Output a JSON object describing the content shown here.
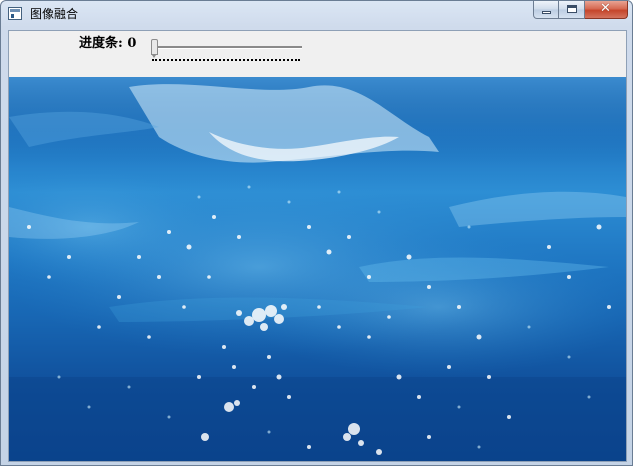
{
  "window": {
    "title": "图像融合",
    "controls": {
      "minimize": "minimize",
      "maximize": "maximize",
      "close": "✕"
    }
  },
  "toolbar": {
    "slider_label": "进度条: 0",
    "slider_value": 0
  },
  "image": {
    "description": "underwater",
    "colors": {
      "deep": "#0c4590",
      "mid": "#1f77c3",
      "light": "#4fb1e8",
      "foam": "#ffffff"
    }
  }
}
